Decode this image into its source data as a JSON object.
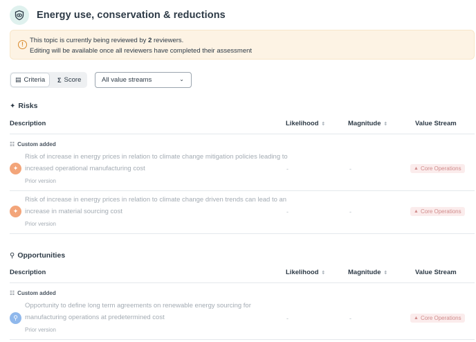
{
  "header": {
    "title": "Energy use, conservation & reductions",
    "icon": "eye-shield-icon"
  },
  "banner": {
    "line1_prefix": "This topic is currently being reviewed by ",
    "reviewer_count": "2",
    "line1_suffix": " reviewers.",
    "line2": "Editing will be available once all reviewers have completed their assessment",
    "color": "#fdf3e4"
  },
  "toolbar": {
    "criteria_label": "Criteria",
    "score_label": "Score",
    "value_stream_select": "All value streams"
  },
  "columns": {
    "description": "Description",
    "likelihood": "Likelihood",
    "magnitude": "Magnitude",
    "value_stream": "Value Stream"
  },
  "risks": {
    "title": "Risks",
    "custom_added": "Custom added",
    "rows": [
      {
        "description": "Risk of increase in energy prices in relation to climate change mitigation policies leading to increased operational manufacturing cost",
        "prior": "Prior version",
        "likelihood": "-",
        "magnitude": "-",
        "value_stream": "Core Operations"
      },
      {
        "description": "Risk of increase in energy prices in relation to climate change driven trends can lead to an increase in material sourcing cost",
        "prior": "Prior version",
        "likelihood": "-",
        "magnitude": "-",
        "value_stream": "Core Operations"
      }
    ]
  },
  "opportunities": {
    "title": "Opportunities",
    "custom_added": "Custom added",
    "rows": [
      {
        "description": "Opportunity to define long term agreements on renewable energy sourcing for manufacturing operations at predetermined cost",
        "prior": "Prior version",
        "likelihood": "-",
        "magnitude": "-",
        "value_stream": "Core Operations"
      }
    ]
  },
  "colors": {
    "risk_icon": "#f3a57a",
    "opportunity_icon": "#8fb8ec",
    "value_stream_tag": "#fbecec"
  }
}
